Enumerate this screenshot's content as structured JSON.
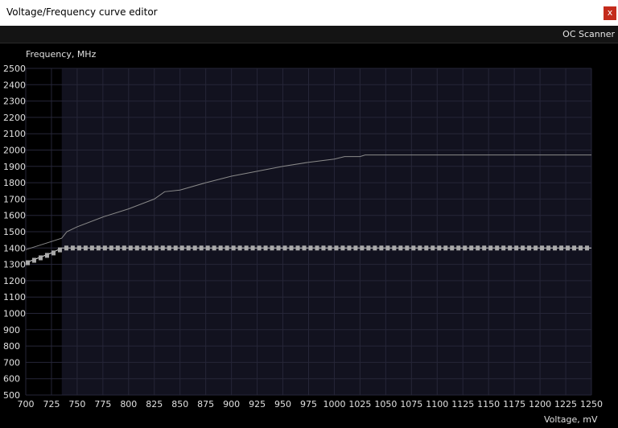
{
  "window": {
    "title": "Voltage/Frequency curve editor",
    "close_label": "x"
  },
  "toolbar": {
    "oc_scanner_label": "OC Scanner"
  },
  "colors": {
    "plot_background": "#12121f",
    "locked_region": "#000000",
    "grid": "#262638",
    "curve": "#8a8a8a",
    "points": "#aaaaaa",
    "close_button": "#c42b1c"
  },
  "chart_data": {
    "type": "line",
    "ylabel": "Frequency, MHz",
    "xlabel": "Voltage, mV",
    "xlim": [
      700,
      1250
    ],
    "ylim": [
      500,
      2500
    ],
    "x_ticks": [
      700,
      725,
      750,
      775,
      800,
      825,
      850,
      875,
      900,
      925,
      950,
      975,
      1000,
      1025,
      1050,
      1075,
      1100,
      1125,
      1150,
      1175,
      1200,
      1225,
      1250
    ],
    "y_ticks": [
      500,
      600,
      700,
      800,
      900,
      1000,
      1100,
      1200,
      1300,
      1400,
      1500,
      1600,
      1700,
      1800,
      1900,
      2000,
      2100,
      2200,
      2300,
      2400,
      2500
    ],
    "grid": true,
    "locked_region_until_mv": 735,
    "series": [
      {
        "kind": "default-curve",
        "points": [
          [
            700,
            1390
          ],
          [
            725,
            1440
          ],
          [
            735,
            1460
          ],
          [
            740,
            1500
          ],
          [
            750,
            1530
          ],
          [
            775,
            1590
          ],
          [
            800,
            1640
          ],
          [
            825,
            1700
          ],
          [
            835,
            1745
          ],
          [
            850,
            1755
          ],
          [
            875,
            1800
          ],
          [
            900,
            1840
          ],
          [
            925,
            1870
          ],
          [
            950,
            1900
          ],
          [
            975,
            1925
          ],
          [
            1000,
            1945
          ],
          [
            1010,
            1960
          ],
          [
            1025,
            1960
          ],
          [
            1030,
            1970
          ],
          [
            1250,
            1970
          ]
        ]
      },
      {
        "kind": "current-curve",
        "points": [
          [
            700,
            1310
          ],
          [
            725,
            1370
          ],
          [
            735,
            1400
          ],
          [
            1250,
            1400
          ]
        ]
      }
    ]
  }
}
